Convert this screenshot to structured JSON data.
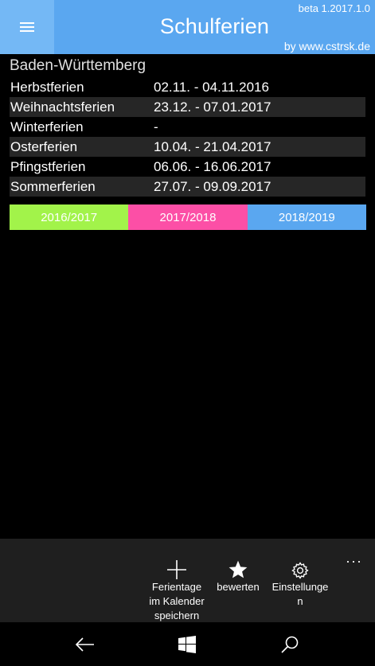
{
  "header": {
    "title": "Schulferien",
    "version": "beta 1.2017.1.0",
    "byline": "by www.cstrsk.de",
    "background": "#5aa7f0",
    "menu_icon": "hamburger-menu-icon"
  },
  "state": "Baden-Württemberg",
  "holidays": [
    {
      "name": "Herbstferien",
      "dates": "02.11. - 04.11.2016"
    },
    {
      "name": "Weihnachtsferien",
      "dates": "23.12. - 07.01.2017"
    },
    {
      "name": "Winterferien",
      "dates": "-"
    },
    {
      "name": "Osterferien",
      "dates": "10.04. - 21.04.2017"
    },
    {
      "name": "Pfingstferien",
      "dates": "06.06. - 16.06.2017"
    },
    {
      "name": "Sommerferien",
      "dates": "27.07. - 09.09.2017"
    }
  ],
  "years": [
    {
      "label": "2016/2017",
      "color": "#a2f34a"
    },
    {
      "label": "2017/2018",
      "color": "#fc4fa6"
    },
    {
      "label": "2018/2019",
      "color": "#5aa7f0"
    }
  ],
  "appbar": {
    "save_calendar": {
      "line1": "Ferientage",
      "line2": "im Kalender",
      "line3": "speichern",
      "icon": "plus-icon"
    },
    "rate": {
      "label": "bewerten",
      "icon": "star-icon"
    },
    "settings": {
      "line1": "Einstellunge",
      "line2": "n",
      "icon": "gear-icon"
    },
    "more": "···"
  },
  "navbar": {
    "back_icon": "back-arrow-icon",
    "home_icon": "windows-logo-icon",
    "search_icon": "search-icon"
  }
}
